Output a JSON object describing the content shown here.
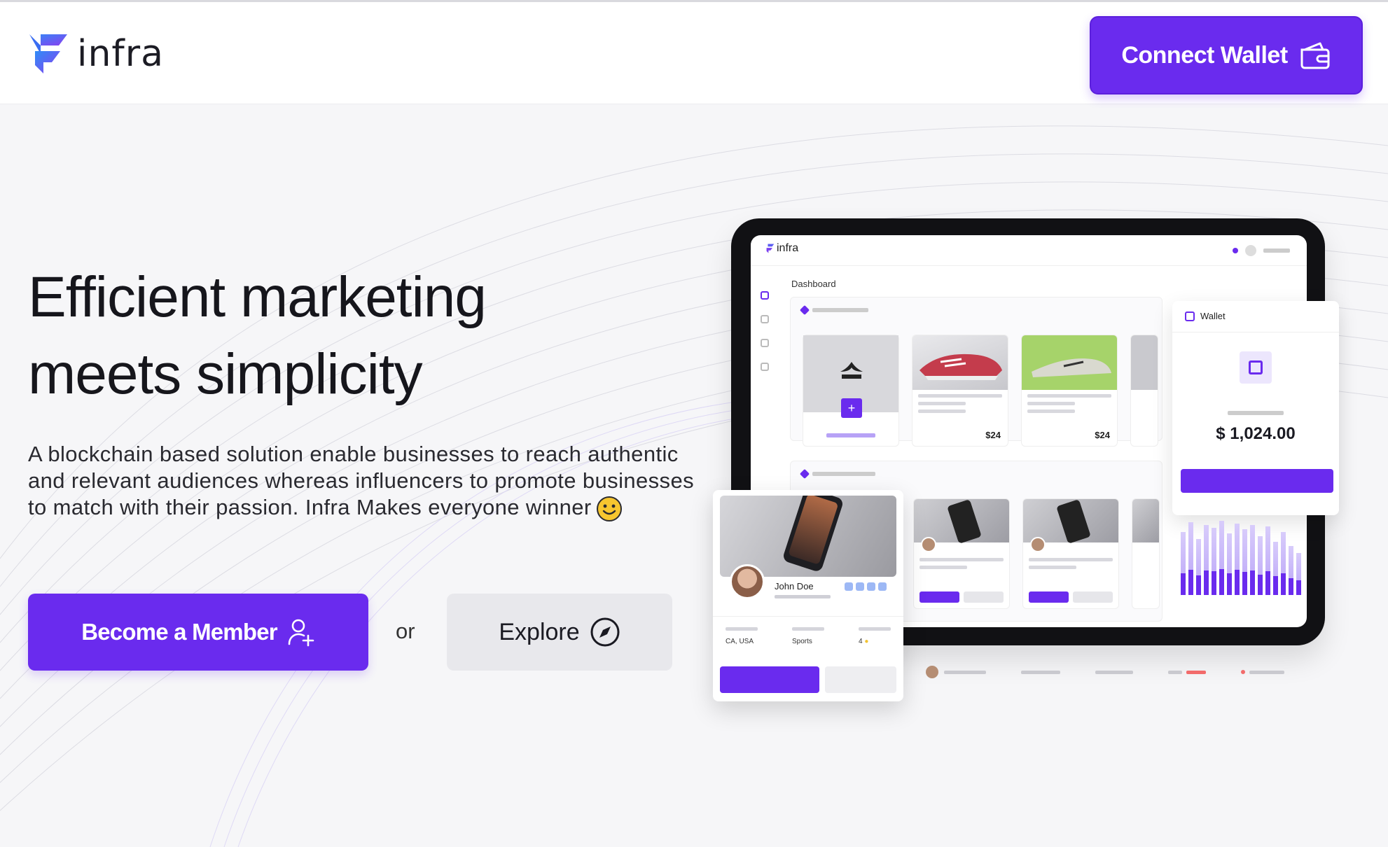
{
  "header": {
    "brand": "infra",
    "connect_label": "Connect Wallet"
  },
  "hero": {
    "title_line1": "Efficient marketing",
    "title_line2": "meets simplicity",
    "description": "A blockchain based solution enable businesses to reach authentic and relevant audiences whereas influencers to promote businesses to match with their passion. Infra Makes everyone winner",
    "member_label": "Become a Member",
    "or_label": "or",
    "explore_label": "Explore"
  },
  "mockup": {
    "brand": "infra",
    "page_title": "Dashboard",
    "wallet_title": "Wallet",
    "wallet_amount": "$ 1,024.00",
    "influencer_name": "John Doe",
    "influencer_location": "CA, USA",
    "influencer_category": "Sports",
    "influencer_rating": "4",
    "products": [
      {
        "price": "$24"
      },
      {
        "price": "$24"
      }
    ]
  },
  "colors": {
    "accent": "#6a2bee",
    "explore_bg": "#e8e8ec"
  },
  "icons": {
    "logo": "infra-logo-icon",
    "wallet": "wallet-icon",
    "user_add": "user-add-icon",
    "compass": "compass-icon",
    "smiley": "smiley-icon"
  }
}
